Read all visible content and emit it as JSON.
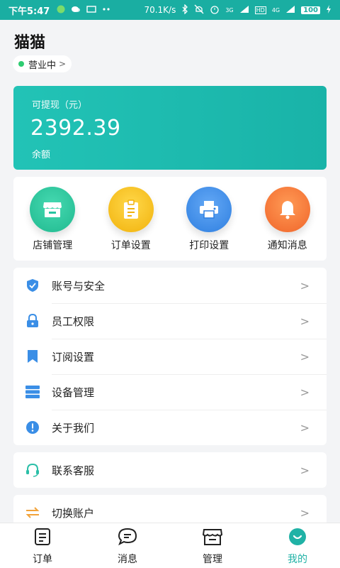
{
  "status_bar": {
    "time": "下午5:47",
    "speed": "70.1K/s",
    "signal_labels": [
      "3G",
      "HD",
      "4G"
    ],
    "battery": "100",
    "left_icons": [
      "app-icon",
      "wechat-icon",
      "screen-icon",
      "more-dots-icon"
    ]
  },
  "shop": {
    "name": "猫猫",
    "status": "营业中",
    "status_chevron": ">"
  },
  "balance": {
    "label": "可提现（元）",
    "amount": "2392.39",
    "sub_label": "余额"
  },
  "quick_actions": [
    {
      "label": "店铺管理",
      "icon": "store-icon",
      "color": "#27c4a0"
    },
    {
      "label": "订单设置",
      "icon": "clipboard-icon",
      "color": "#f7c21b"
    },
    {
      "label": "打印设置",
      "icon": "printer-icon",
      "color": "#3b8fe8"
    },
    {
      "label": "通知消息",
      "icon": "bell-icon",
      "color": "#f67a3b"
    }
  ],
  "menu": [
    {
      "label": "账号与安全",
      "icon": "shield-icon"
    },
    {
      "label": "员工权限",
      "icon": "lock-icon"
    },
    {
      "label": "订阅设置",
      "icon": "bookmark-icon"
    },
    {
      "label": "设备管理",
      "icon": "server-icon"
    },
    {
      "label": "关于我们",
      "icon": "info-icon"
    }
  ],
  "support": {
    "label": "联系客服",
    "icon": "headset-icon"
  },
  "switch_account": {
    "label": "切换账户",
    "icon": "swap-icon"
  },
  "chevron": ">",
  "tabs": [
    {
      "label": "订单",
      "icon": "order-list-icon"
    },
    {
      "label": "消息",
      "icon": "message-icon"
    },
    {
      "label": "管理",
      "icon": "manage-store-icon"
    },
    {
      "label": "我的",
      "icon": "profile-smile-icon",
      "active": true
    }
  ],
  "colors": {
    "accent": "#1aaea2",
    "active_tab": "#20b2a6"
  }
}
